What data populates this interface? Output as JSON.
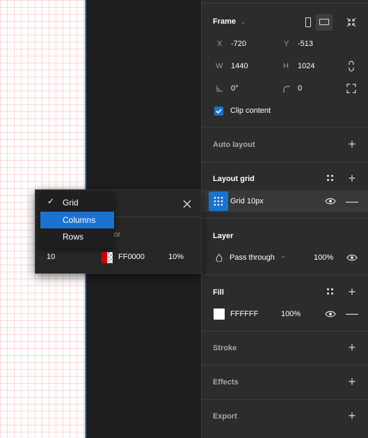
{
  "frame": {
    "title": "Frame",
    "x_label": "X",
    "x_value": "-720",
    "y_label": "Y",
    "y_value": "-513",
    "w_label": "W",
    "w_value": "1440",
    "h_label": "H",
    "h_value": "1024",
    "rotation_value": "0°",
    "radius_value": "0",
    "clip_content_label": "Clip content",
    "clip_content_checked": true
  },
  "auto_layout": {
    "title": "Auto layout"
  },
  "layout_grid": {
    "title": "Layout grid",
    "item_label": "Grid 10px"
  },
  "layer": {
    "title": "Layer",
    "blend_mode": "Pass through",
    "opacity": "100%"
  },
  "fill": {
    "title": "Fill",
    "hex": "FFFFFF",
    "opacity": "100%",
    "swatch_color": "#ffffff"
  },
  "stroke": {
    "title": "Stroke"
  },
  "effects": {
    "title": "Effects"
  },
  "export": {
    "title": "Export"
  },
  "grid_popup": {
    "size_value": "10",
    "color_header_partial": "lor",
    "color_hex": "FF0000",
    "color_opacity": "10%",
    "swatch_color": "#ff0000"
  },
  "grid_type_dropdown": {
    "options": [
      {
        "label": "Grid",
        "selected": true
      },
      {
        "label": "Columns",
        "highlighted": true
      },
      {
        "label": "Rows"
      }
    ]
  },
  "colors": {
    "accent": "#1a73cf",
    "panel_bg": "#2c2c2c",
    "canvas_edge": "#2f7fd6"
  }
}
